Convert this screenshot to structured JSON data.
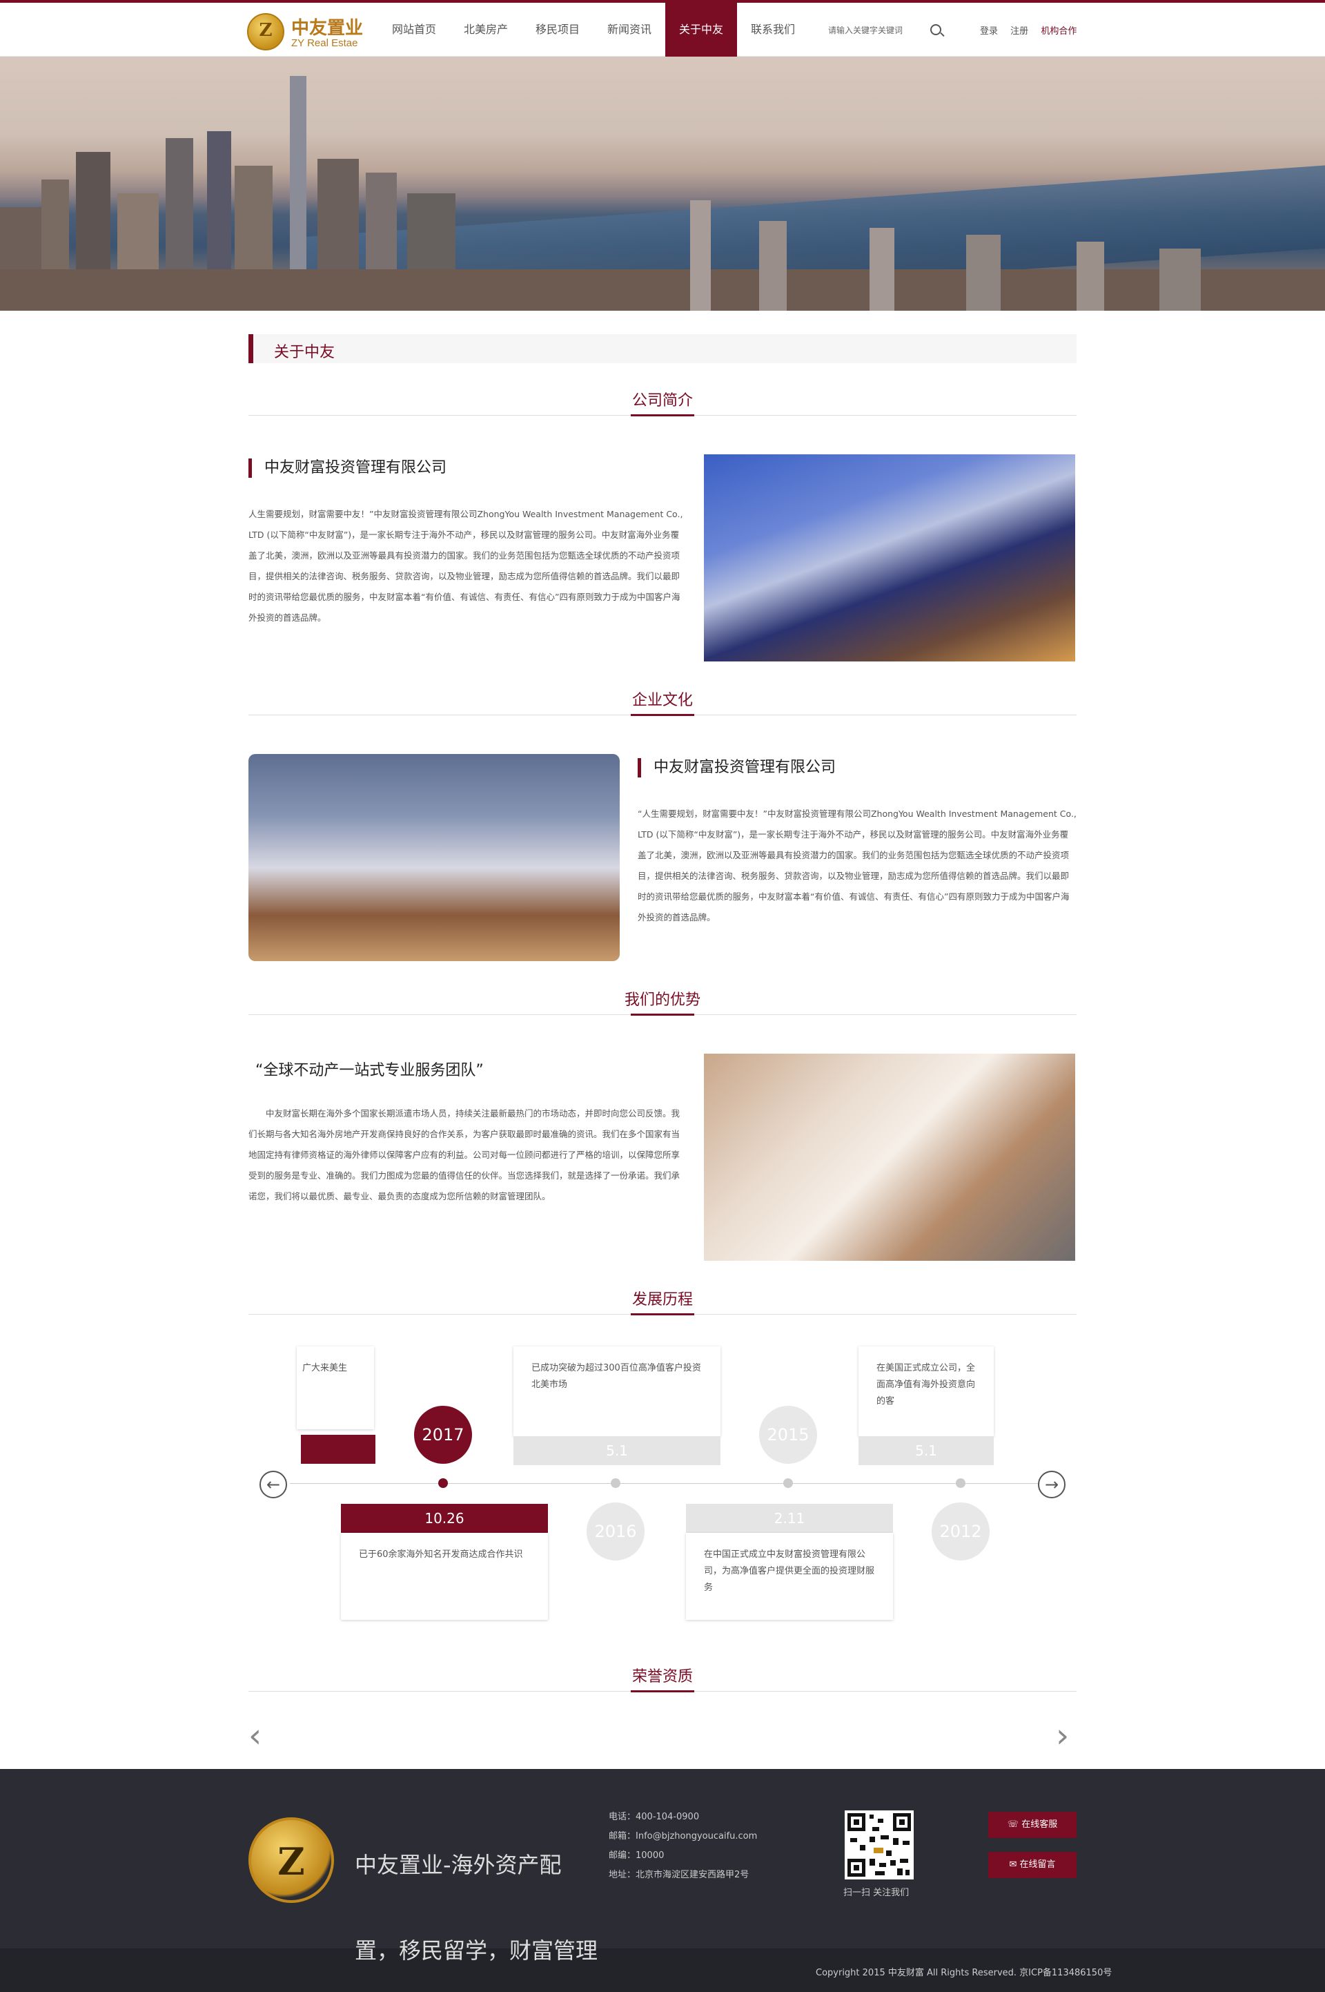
{
  "header": {
    "logo_cn": "中友置业",
    "logo_en": "ZY Real Estae",
    "nav": [
      "网站首页",
      "北美房产",
      "移民项目",
      "新闻资讯",
      "关于中友",
      "联系我们"
    ],
    "active_nav_index": 4,
    "search_placeholder": "请输入关键字关键词",
    "links": [
      "登录",
      "注册",
      "机构合作"
    ]
  },
  "page": {
    "section_title": "关于中友"
  },
  "intro": {
    "heading": "公司简介",
    "company_name": "中友财富投资管理有限公司",
    "paragraph": "人生需要规划，财富需要中友！”中友财富投资管理有限公司ZhongYou Wealth Investment Management Co., LTD (以下简称“中友财富”)，是一家长期专注于海外不动产，移民以及财富管理的服务公司。中友财富海外业务覆盖了北美，澳洲，欧洲以及亚洲等最具有投资潜力的国家。我们的业务范围包括为您甄选全球优质的不动产投资项目，提供相关的法律咨询、税务服务、贷款咨询，以及物业管理，励志成为您所值得信赖的首选品牌。我们以最即时的资讯带给您最优质的服务，中友财富本着“有价值、有诚信、有责任、有信心”四有原则致力于成为中国客户海外投资的首选品牌。"
  },
  "culture": {
    "heading": "企业文化",
    "company_name": "中友财富投资管理有限公司",
    "paragraph": "“人生需要规划，财富需要中友！”中友财富投资管理有限公司ZhongYou Wealth Investment Management Co., LTD (以下简称“中友财富”)，是一家长期专注于海外不动产，移民以及财富管理的服务公司。中友财富海外业务覆盖了北美，澳洲，欧洲以及亚洲等最具有投资潜力的国家。我们的业务范围包括为您甄选全球优质的不动产投资项目，提供相关的法律咨询、税务服务、贷款咨询，以及物业管理，励志成为您所值得信赖的首选品牌。我们以最即时的资讯带给您最优质的服务，中友财富本着“有价值、有诚信、有责任、有信心”四有原则致力于成为中国客户海外投资的首选品牌。"
  },
  "advantage": {
    "heading": "我们的优势",
    "title": "“全球不动产一站式专业服务团队”",
    "paragraph": "中友财富长期在海外多个国家长期派遣市场人员，持续关注最新最热门的市场动态，并即时向您公司反馈。我们长期与各大知名海外房地产开发商保持良好的合作关系，为客户获取最即时最准确的资讯。我们在多个国家有当地固定持有律师资格证的海外律师以保障客户应有的利益。公司对每一位顾问都进行了严格的培训，以保障您所享受到的服务是专业、准确的。我们力图成为您最的值得信任的伙伴。当您选择我们，就是选择了一份承诺。我们承诺您，我们将以最优质、最专业、最负责的态度成为您所信赖的财富管理团队。"
  },
  "history": {
    "heading": "发展历程",
    "items": [
      {
        "text": "广大来美生",
        "date": "",
        "year": ""
      },
      {
        "text": "已于60余家海外知名开发商达成合作共识",
        "date": "10.26",
        "year": "2017"
      },
      {
        "text": "已成功突破为超过300百位高净值客户投资北美市场",
        "date": "5.1",
        "year": "2016"
      },
      {
        "text": "在中国正式成立中友财富投资管理有限公司，为高净值客户提供更全面的投资理财服务",
        "date": "2.11",
        "year": "2015"
      },
      {
        "text": "在美国正式成立公司，全面高净值有海外投资意向的客",
        "date": "5.1",
        "year": "2012"
      }
    ],
    "prev_label": "←",
    "next_label": "→"
  },
  "honor": {
    "heading": "荣誉资质",
    "prev_label": "‹",
    "next_label": "›"
  },
  "footer": {
    "slogan1": "中友置业-海外资产配",
    "slogan2": "置，移民留学，财富管理",
    "phone": "电话：400-104-0900",
    "email": "邮箱：Info@bjzhongyoucaifu.com",
    "postcode": "邮编：10000",
    "address": "地址：北京市海淀区建安西路甲2号",
    "qr_label": "扫一扫 关注我们",
    "btn_service": "在线客服",
    "btn_message": "在线留言",
    "copyright": "Copyright 2015 中友财富 All Rights Reserved. 京ICP备113486150号",
    "accent_color": "#7a0c24"
  }
}
